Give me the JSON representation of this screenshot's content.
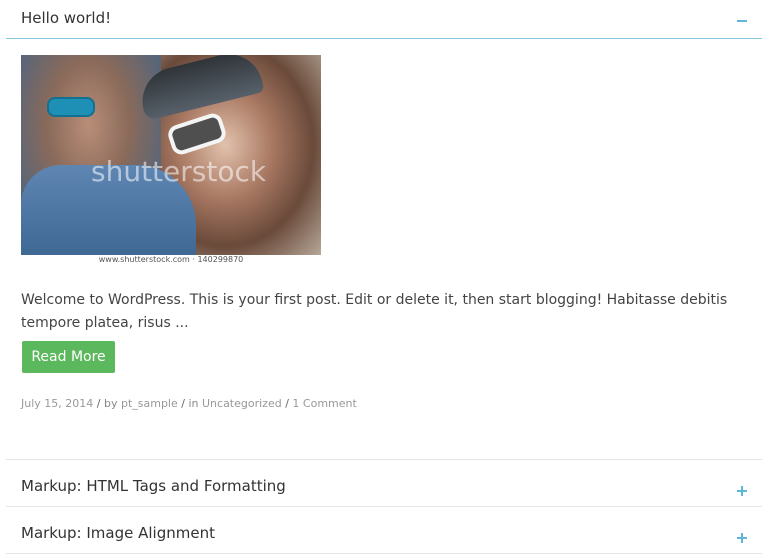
{
  "post": {
    "title": "Hello world!",
    "image_watermark": "shutterstock",
    "image_caption": "www.shutterstock.com · 140299870",
    "excerpt": "Welcome to WordPress. This is your first post. Edit or delete it, then start blogging! Habitasse debitis tempore platea, risus ...",
    "read_more_label": "Read More",
    "meta": {
      "date": "July 15, 2014",
      "sep1": " / ",
      "by": "by ",
      "author": "pt_sample",
      "sep2": " / ",
      "in": "in ",
      "category": "Uncategorized",
      "sep3": " / ",
      "comments": "1 Comment"
    }
  },
  "collapsed_items": [
    {
      "title": "Markup: HTML Tags and Formatting"
    },
    {
      "title": "Markup: Image Alignment"
    }
  ],
  "colors": {
    "accent": "#5fb6d8",
    "button": "#5cb85c"
  },
  "icons": {
    "expanded": "minus-icon",
    "collapsed": "plus-icon"
  }
}
